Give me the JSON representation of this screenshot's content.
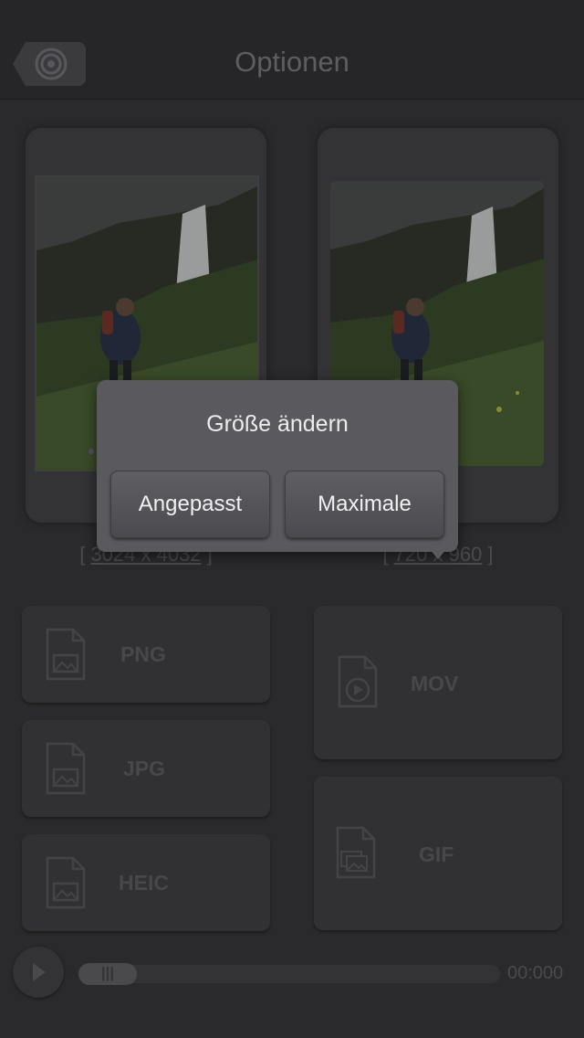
{
  "header": {
    "title": "Optionen",
    "back_icon": "camera-lens-icon"
  },
  "previews": {
    "left": {
      "dimensions": "3024 x 4032"
    },
    "right": {
      "dimensions": "720 x 960"
    }
  },
  "formats": {
    "png": "PNG",
    "jpg": "JPG",
    "heic": "HEIC",
    "mov": "MOV",
    "gif": "GIF"
  },
  "playback": {
    "time": "00:000",
    "thumb_glyph": "|||"
  },
  "popup": {
    "title": "Größe ändern",
    "buttons": {
      "fit": "Angepasst",
      "max": "Maximale"
    }
  },
  "colors": {
    "background": "#2a2a2c",
    "popup": "#5a5a5e",
    "dim_text": "#4b4b4e"
  }
}
